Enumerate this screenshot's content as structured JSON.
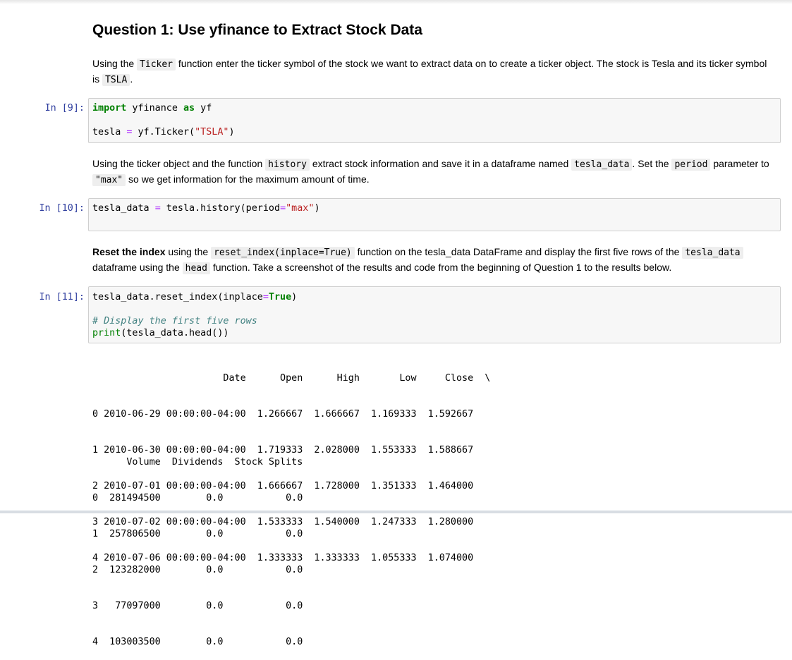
{
  "heading": "Question 1: Use yfinance to Extract Stock Data",
  "md1": {
    "t1": "Using the ",
    "c1": "Ticker",
    "t2": " function enter the ticker symbol of the stock we want to extract data on to create a ticker object. The stock is Tesla and its ticker symbol is ",
    "c2": "TSLA",
    "t3": "."
  },
  "cell9": {
    "prompt": "In [9]:",
    "l1_kw1": "import",
    "l1_mod": " yfinance ",
    "l1_kw2": "as",
    "l1_alias": " yf",
    "l2_a": "tesla ",
    "l2_op": "=",
    "l2_b": " yf.Ticker(",
    "l2_str": "\"TSLA\"",
    "l2_c": ")"
  },
  "md2": {
    "t1": "Using the ticker object and the function ",
    "c1": "history",
    "t2": " extract stock information and save it in a dataframe named ",
    "c2": "tesla_data",
    "t3": ". Set the ",
    "c3": "period",
    "t4": " parameter to ",
    "c4": "\"max\"",
    "t5": " so we get information for the maximum amount of time."
  },
  "cell10": {
    "prompt": "In [10]:",
    "a": "tesla_data ",
    "op": "=",
    "b": " tesla.history(period",
    "op2": "=",
    "str": "\"max\"",
    "c": ")"
  },
  "md3": {
    "bold": "Reset the index",
    "t1": " using the ",
    "c1": "reset_index(inplace=True)",
    "t2": " function on the tesla_data DataFrame and display the first five rows of the ",
    "c2": "tesla_data",
    "t3": " dataframe using the ",
    "c3": "head",
    "t4": " function. Take a screenshot of the results and code from the beginning of Question 1 to the results below."
  },
  "cell11": {
    "prompt": "In [11]:",
    "l1_a": "tesla_data.reset_index(inplace",
    "l1_op": "=",
    "l1_kw": "True",
    "l1_b": ")",
    "comment": "# Display the first five rows",
    "l3_bi": "print",
    "l3_b": "(tesla_data.head())"
  },
  "output": {
    "block1": [
      "                       Date      Open      High       Low     Close  \\",
      "0 2010-06-29 00:00:00-04:00  1.266667  1.666667  1.169333  1.592667",
      "1 2010-06-30 00:00:00-04:00  1.719333  2.028000  1.553333  1.588667",
      "2 2010-07-01 00:00:00-04:00  1.666667  1.728000  1.351333  1.464000",
      "3 2010-07-02 00:00:00-04:00  1.533333  1.540000  1.247333  1.280000",
      "4 2010-07-06 00:00:00-04:00  1.333333  1.333333  1.055333  1.074000"
    ],
    "block2": [
      "      Volume  Dividends  Stock Splits",
      "0  281494500        0.0           0.0",
      "1  257806500        0.0           0.0",
      "2  123282000        0.0           0.0",
      "3   77097000        0.0           0.0",
      "4  103003500        0.0           0.0"
    ]
  }
}
